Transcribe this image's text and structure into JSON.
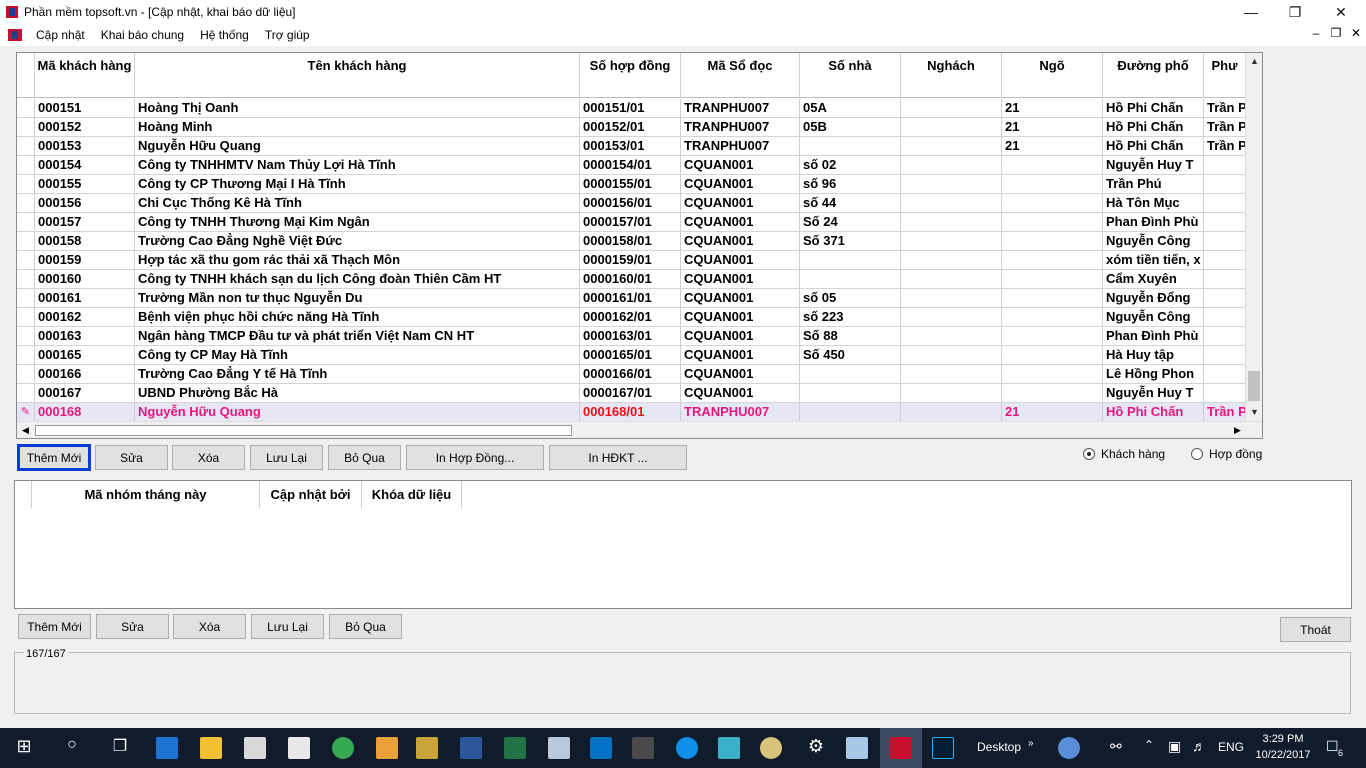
{
  "window": {
    "title": "Phần mềm topsoft.vn - [Cập nhật, khai báo dữ liệu]",
    "minimize_icon": "—",
    "maximize_icon": "❐",
    "close_icon": "✕"
  },
  "menu": {
    "items": [
      "Cập nhật",
      "Khai báo chung",
      "Hệ thống",
      "Trợ giúp"
    ],
    "mdi_minimize": "–",
    "mdi_restore": "❐",
    "mdi_close": "✕"
  },
  "grid": {
    "columns": [
      "",
      "Mã khách hàng",
      "Tên khách hàng",
      "Số hợp đồng",
      "Mã Sổ đọc",
      "Số nhà",
      "Nghách",
      "Ngõ",
      "Đường phố",
      "Phư"
    ],
    "rows": [
      [
        "",
        "000151",
        "Hoàng Thị Oanh",
        "000151/01",
        "TRANPHU007",
        "05A",
        "",
        "21",
        "Hồ Phi Chấn",
        "Trần P"
      ],
      [
        "",
        "000152",
        "Hoàng Minh",
        "000152/01",
        "TRANPHU007",
        "05B",
        "",
        "21",
        "Hồ Phi Chấn",
        "Trần P"
      ],
      [
        "",
        "000153",
        "Nguyễn Hữu Quang",
        "000153/01",
        "TRANPHU007",
        "",
        "",
        "21",
        "Hồ Phi Chấn",
        "Trần P"
      ],
      [
        "",
        "000154",
        "Công ty TNHHMTV Nam Thủy Lợi Hà Tĩnh",
        "0000154/01",
        "CQUAN001",
        "số 02",
        "",
        "",
        "Nguyễn Huy T",
        ""
      ],
      [
        "",
        "000155",
        "Công ty CP Thương Mại I Hà Tĩnh",
        "0000155/01",
        "CQUAN001",
        "số 96",
        "",
        "",
        "Trần Phú",
        ""
      ],
      [
        "",
        "000156",
        "Chi Cục Thống Kê Hà Tĩnh",
        "0000156/01",
        "CQUAN001",
        "số 44",
        "",
        "",
        "Hà Tôn Mục",
        ""
      ],
      [
        "",
        "000157",
        "Công ty TNHH Thương Mại Kim Ngân",
        "0000157/01",
        "CQUAN001",
        "Số 24",
        "",
        "",
        "Phan Đình Phù",
        ""
      ],
      [
        "",
        "000158",
        "Trường Cao Đẳng Nghề Việt Đức",
        "0000158/01",
        "CQUAN001",
        "Số 371",
        "",
        "",
        "Nguyễn Công",
        ""
      ],
      [
        "",
        "000159",
        "Hợp tác xã thu gom rác thải xã Thạch Môn",
        "0000159/01",
        "CQUAN001",
        "",
        "",
        "",
        "xóm tiền tiến, x",
        ""
      ],
      [
        "",
        "000160",
        "Công ty TNHH khách sạn du lịch Công đoàn  Thiên Cầm HT",
        "0000160/01",
        "CQUAN001",
        "",
        "",
        "",
        " Cẩm Xuyên",
        ""
      ],
      [
        "",
        "000161",
        "Trường Mần non tư thục Nguyễn Du",
        "0000161/01",
        "CQUAN001",
        " số 05",
        "",
        "",
        "Nguyễn Đổng",
        ""
      ],
      [
        "",
        "000162",
        "Bệnh viện phục hồi chức năng Hà Tĩnh",
        "0000162/01",
        "CQUAN001",
        "số 223",
        "",
        "",
        "Nguyễn Công",
        ""
      ],
      [
        "",
        "000163",
        "Ngân hàng TMCP Đầu tư và phát triển Việt Nam CN HT",
        "0000163/01",
        "CQUAN001",
        "Số 88",
        "",
        "",
        "Phan Đình Phù",
        ""
      ],
      [
        "",
        "000165",
        "Công ty CP May Hà Tĩnh",
        "0000165/01",
        "CQUAN001",
        "Số 450",
        "",
        "",
        "Hà Huy tập",
        ""
      ],
      [
        "",
        "000166",
        "Trường Cao Đẳng Y tế Hà Tĩnh",
        "0000166/01",
        "CQUAN001",
        "",
        "",
        "",
        "Lê Hồng Phon",
        ""
      ],
      [
        "",
        "000167",
        "UBND Phường Bắc Hà",
        "0000167/01",
        "CQUAN001",
        "",
        "",
        "",
        "Nguyễn Huy T",
        ""
      ],
      [
        "✎",
        "000168",
        "Nguyễn Hữu Quang",
        "000168/01",
        "TRANPHU007",
        "",
        "",
        "21",
        "Hồ Phi Chấn",
        "Trần P"
      ]
    ],
    "active_row_index": 16
  },
  "buttons_top": {
    "add": "Thêm Mới",
    "edit": "Sửa",
    "delete": "Xóa",
    "save": "Lưu Lại",
    "skip": "Bỏ Qua",
    "print_contract": "In Hợp Đồng...",
    "print_hdkt": "In HĐKT ..."
  },
  "radio": {
    "customer": "Khách hàng",
    "contract": "Hợp đồng",
    "selected": "customer"
  },
  "grid2": {
    "columns": [
      "",
      "Mã nhóm tháng này",
      "Cập nhật bởi",
      "Khóa dữ liệu"
    ]
  },
  "buttons_bottom": {
    "add": "Thêm Mới",
    "edit": "Sửa",
    "delete": "Xóa",
    "save": "Lưu Lại",
    "skip": "Bỏ Qua",
    "exit": "Thoát"
  },
  "status": {
    "record_counter": "167/167"
  },
  "taskbar": {
    "desktop_label": "Desktop",
    "language": "ENG",
    "time": "3:29 PM",
    "date": "10/22/2017",
    "notification_count": "6"
  }
}
